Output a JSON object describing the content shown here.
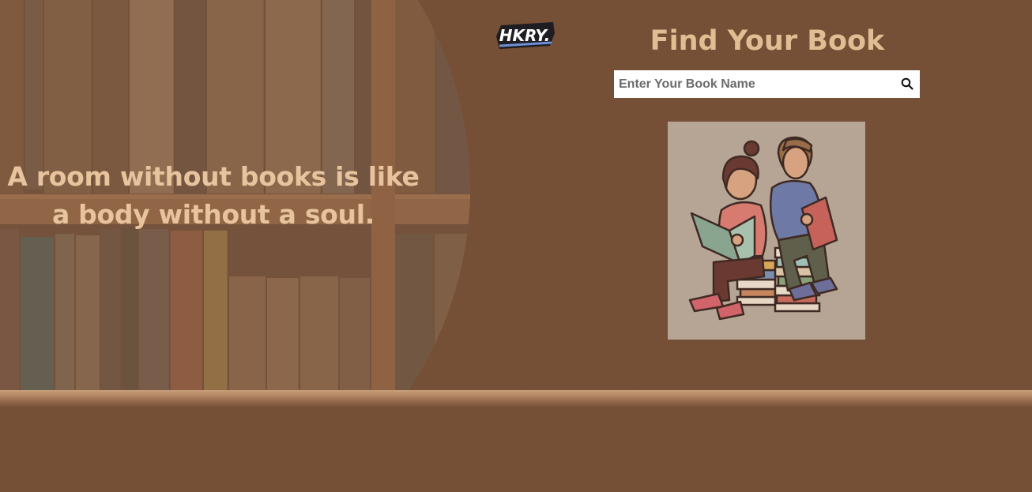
{
  "hero": {
    "quote_line1": "A room without books is like",
    "quote_line2": "a body without a soul."
  },
  "logo": {
    "text": "HKRY."
  },
  "main": {
    "title": "Find Your Book",
    "search": {
      "placeholder": "Enter Your Book Name",
      "value": "",
      "button_icon": "search-icon"
    },
    "illustration": "kids-reading-on-book-stacks"
  },
  "colors": {
    "page_background": "#754f36",
    "title_text": "#e2bd94",
    "quote_text": "#e7c49d",
    "illustration_background": "#b6a595"
  }
}
